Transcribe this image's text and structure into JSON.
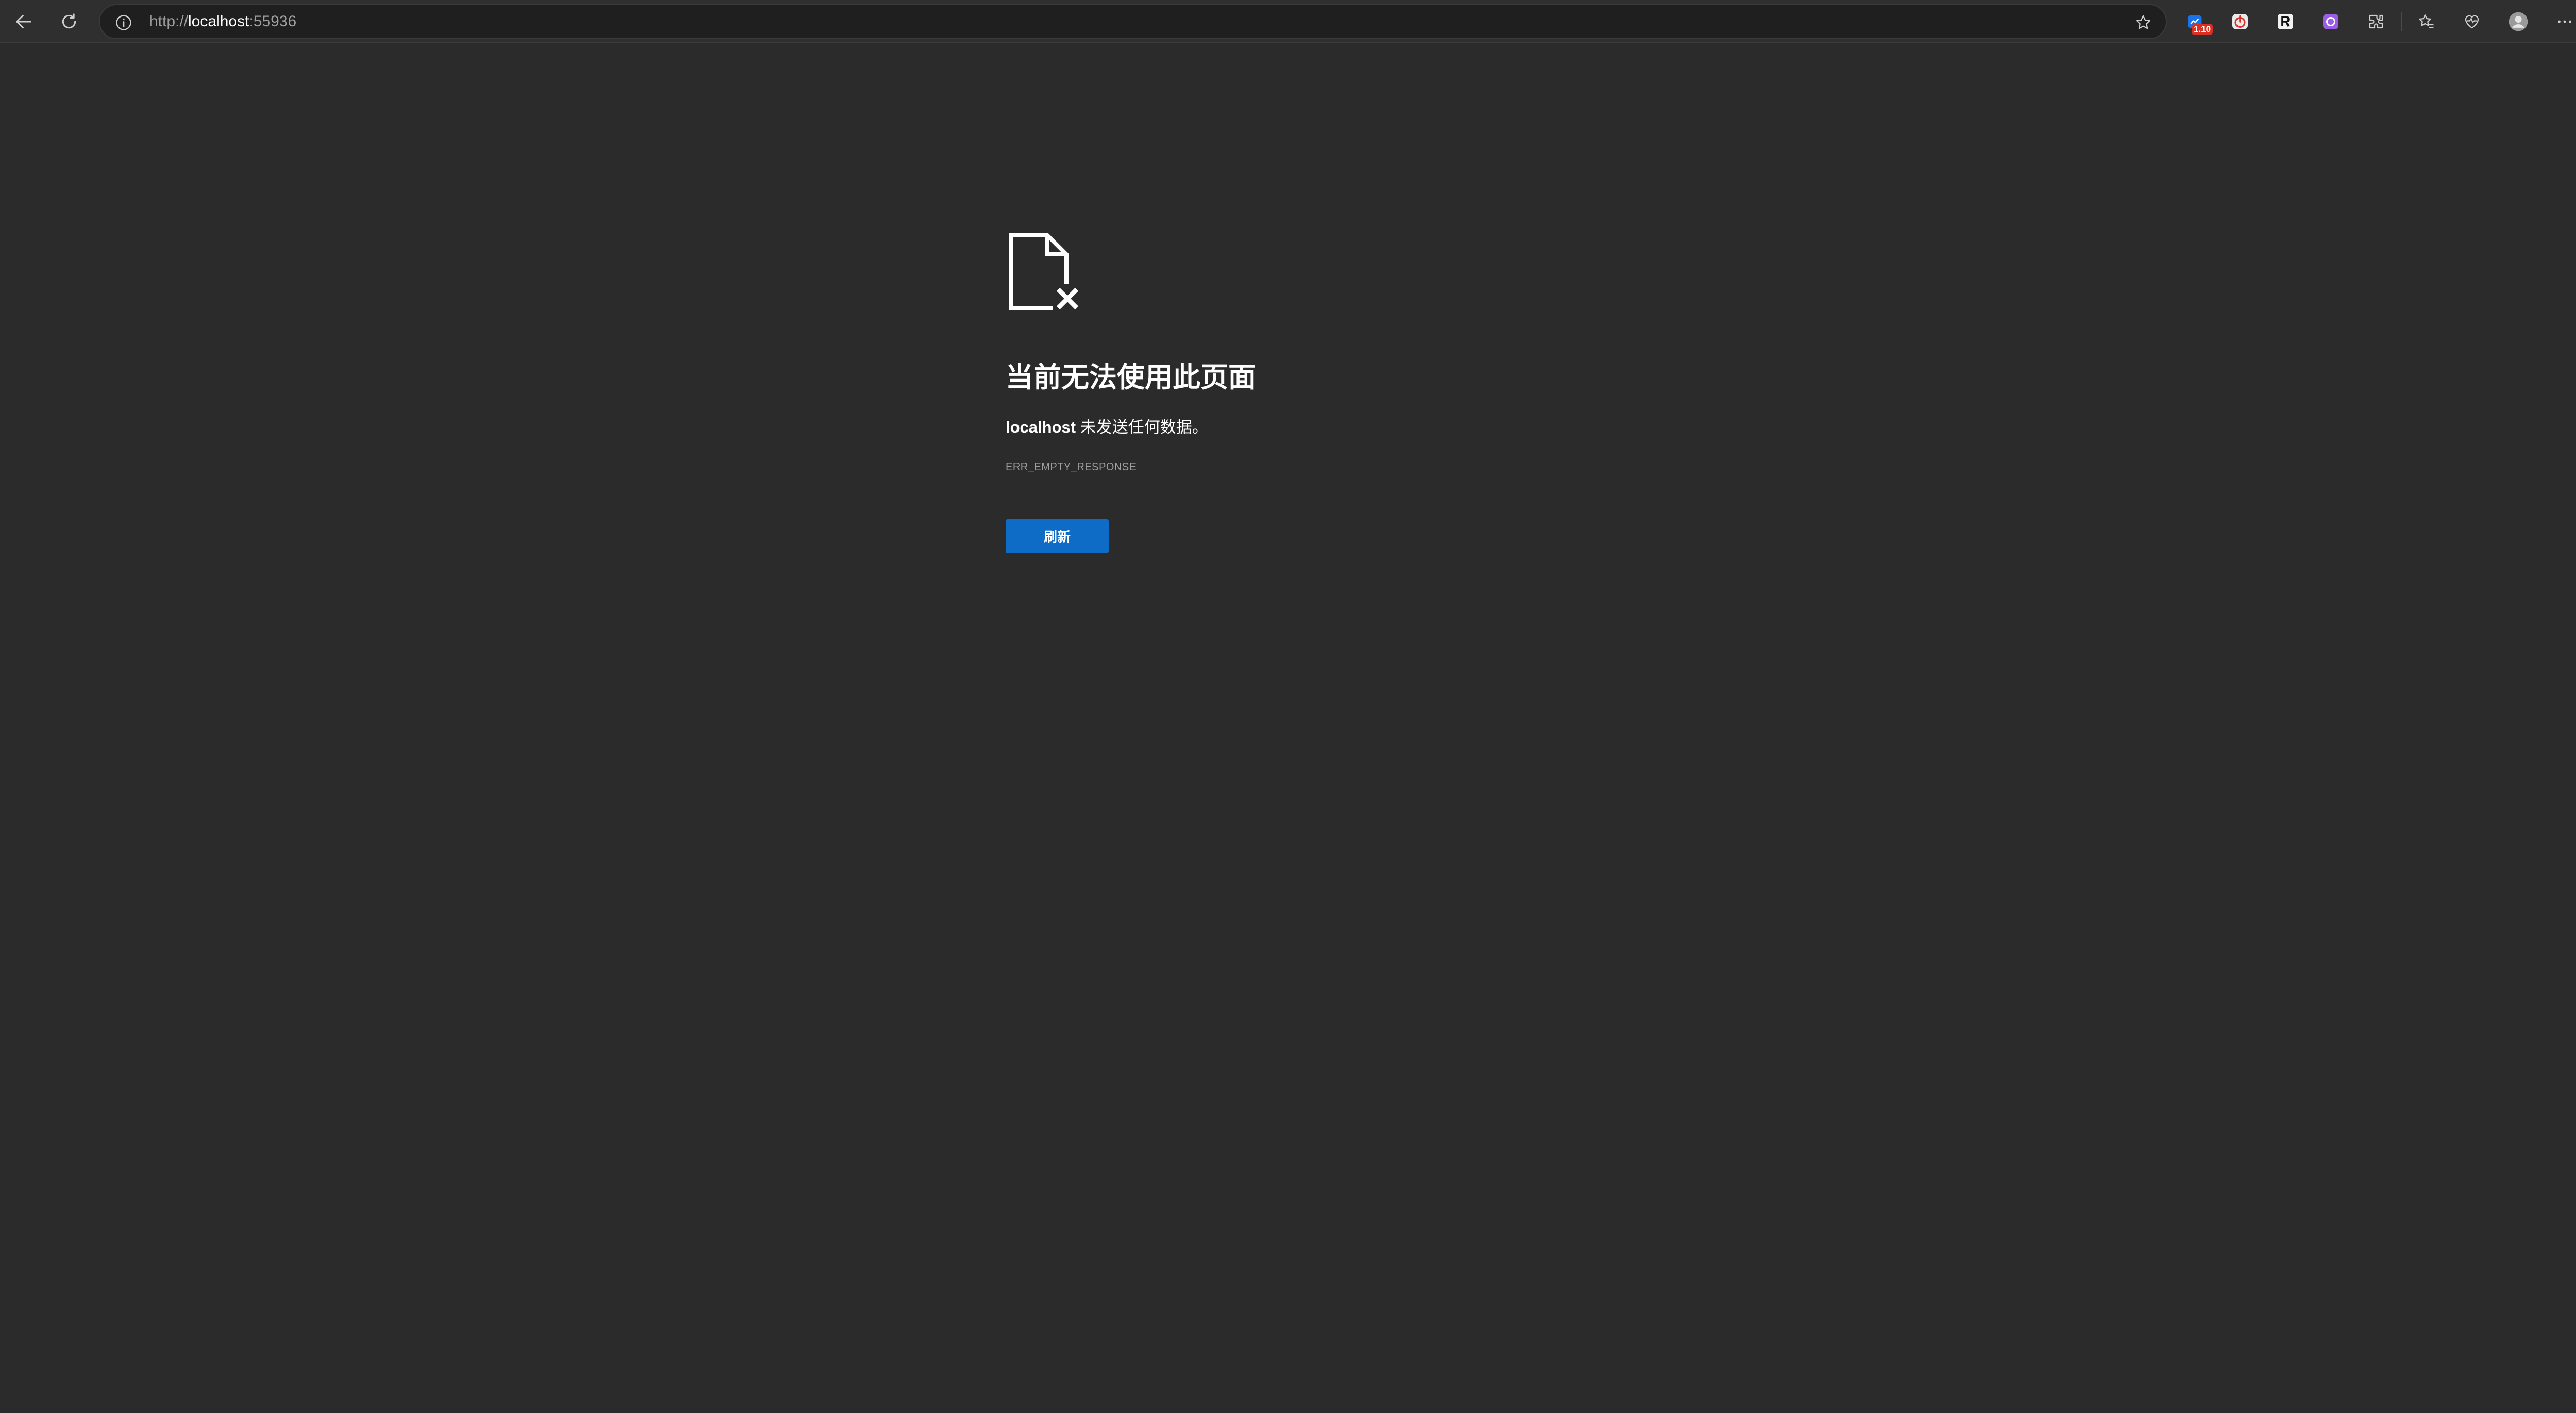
{
  "browser": {
    "url_scheme": "http://",
    "url_host": "localhost",
    "url_port": ":55936",
    "extension_badge": "1.10",
    "icons": [
      "back-arrow-icon",
      "reload-icon",
      "site-info-icon",
      "favorite-star-icon",
      "extension-icons",
      "favorites-icon",
      "browser-essentials-icon",
      "profile-avatar-icon",
      "more-menu-icon",
      "copilot-icon"
    ]
  },
  "error_page": {
    "title": "当前无法使用此页面",
    "host": "localhost",
    "message": " 未发送任何数据。",
    "error_code": "ERR_EMPTY_RESPONSE",
    "reload_label": "刷新"
  },
  "colors": {
    "background": "#2b2b2b",
    "toolbar": "#2f2f2f",
    "button_blue": "#0f6cc6",
    "text": "#ffffff",
    "muted_text": "#a0a0a0"
  }
}
